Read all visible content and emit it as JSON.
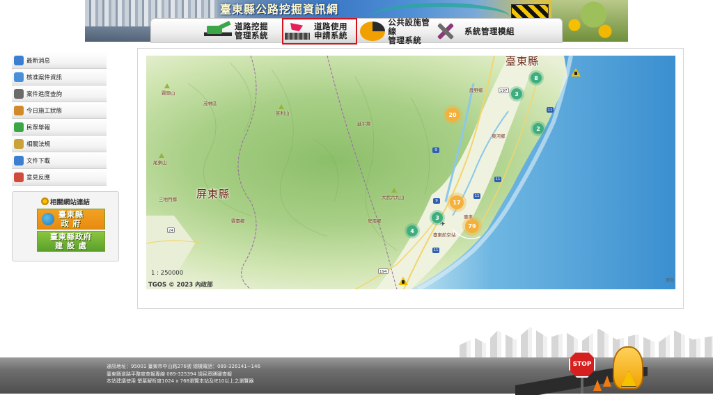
{
  "header": {
    "site_title": "臺東縣公路挖掘資訊網",
    "nav": [
      {
        "label_line1": "道路挖掘",
        "label_line2": "管理系統"
      },
      {
        "label_line1": "道路使用",
        "label_line2": "申請系統"
      },
      {
        "label_line1": "公共設施管線",
        "label_line2": "管理系統"
      },
      {
        "label_line1": "系統管理模組",
        "label_line2": ""
      }
    ]
  },
  "sidebar": {
    "items": [
      {
        "label": "最新消息",
        "icon": "search-icon",
        "color": "#3b7fd1"
      },
      {
        "label": "核准案件資訊",
        "icon": "document-icon",
        "color": "#4a90d9"
      },
      {
        "label": "案件進度查詢",
        "icon": "progress-icon",
        "color": "#6a6a6a"
      },
      {
        "label": "今日施工狀態",
        "icon": "truck-icon",
        "color": "#d18a2a"
      },
      {
        "label": "民眾舉報",
        "icon": "report-icon",
        "color": "#3aa646"
      },
      {
        "label": "相關法規",
        "icon": "law-icon",
        "color": "#c9a23a"
      },
      {
        "label": "文件下載",
        "icon": "download-icon",
        "color": "#3b7fd1"
      },
      {
        "label": "意見反應",
        "icon": "feedback-icon",
        "color": "#d14a3a"
      }
    ],
    "links_title": "相關網站連結",
    "links": [
      {
        "line1": "臺東縣",
        "line2": "政 府"
      },
      {
        "line1": "臺東縣政府",
        "line2": "建 設 處"
      }
    ]
  },
  "map": {
    "counties": [
      "臺東縣",
      "屏東縣"
    ],
    "places": [
      "霧頭山",
      "茂林區",
      "甚利山",
      "延平鄉",
      "尾寮山",
      "三地門鄉",
      "霧臺鄉",
      "大武六九山",
      "卑南鄉",
      "鹿野鄉",
      "東河鄉",
      "臺東航空站",
      "臺東"
    ],
    "clusters": [
      {
        "count": "8",
        "kind": "green"
      },
      {
        "count": "3",
        "kind": "green"
      },
      {
        "count": "20",
        "kind": "orange"
      },
      {
        "count": "2",
        "kind": "green"
      },
      {
        "count": "17",
        "kind": "orange"
      },
      {
        "count": "3",
        "kind": "green"
      },
      {
        "count": "4",
        "kind": "green"
      },
      {
        "count": "79",
        "kind": "orange"
      }
    ],
    "road_shields": [
      "197",
      "11",
      "9",
      "11",
      "24",
      "9",
      "11",
      "194",
      "11"
    ],
    "scale_text": "1 : 250000",
    "attribution": "TGOS © 2023 內政部",
    "attribution_right": "徑包"
  },
  "footer": {
    "lines": [
      "通訊地址：95001 臺東市中山路276號 總機電話：089-326141~146",
      "臺東縣道路平整度查報專線 089-325394 請民眾踴躍查報",
      "本站建議使用 螢幕解析度1024 x 768瀏覽本站及IE10以上之瀏覽器"
    ],
    "stop_text": "STOP"
  }
}
